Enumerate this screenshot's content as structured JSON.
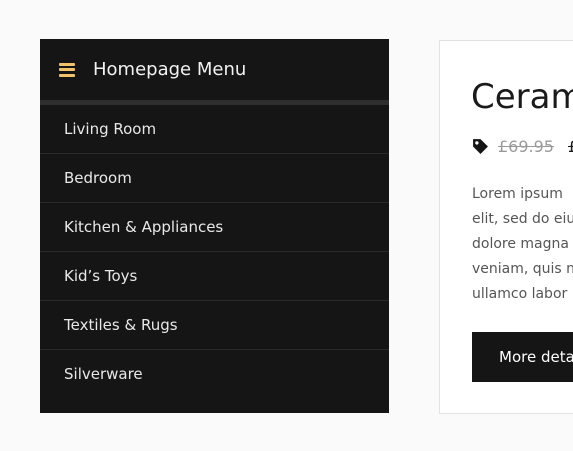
{
  "menu": {
    "title": "Homepage Menu",
    "icon": "hamburger-menu-icon",
    "accent_color": "#f0c36a",
    "items": [
      {
        "label": "Living Room"
      },
      {
        "label": "Bedroom"
      },
      {
        "label": "Kitchen & Appliances"
      },
      {
        "label": "Kid’s Toys"
      },
      {
        "label": "Textiles & Rugs"
      },
      {
        "label": "Silverware"
      }
    ]
  },
  "product": {
    "title": "Ceram",
    "tag_icon": "price-tag-icon",
    "old_price": "£69.95",
    "new_price": "£",
    "description_lines": [
      "Lorem ipsum",
      "elit, sed do eiu",
      "dolore magna",
      "veniam, quis n",
      "ullamco labor"
    ],
    "button_label": "More deta"
  }
}
